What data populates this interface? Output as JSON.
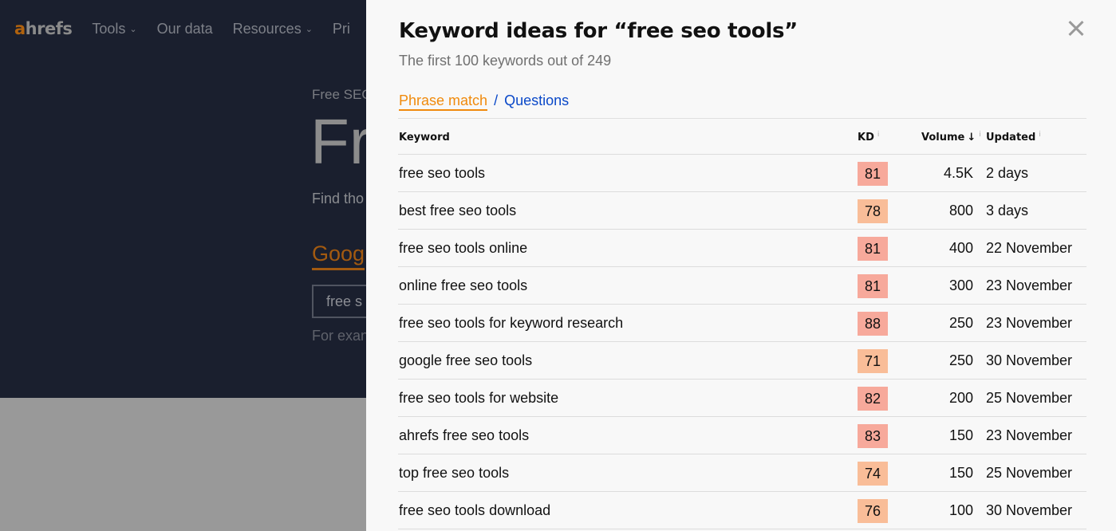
{
  "background": {
    "logo": {
      "accent": "a",
      "rest": "hrefs"
    },
    "nav": [
      {
        "label": "Tools",
        "has_dropdown": true
      },
      {
        "label": "Our data",
        "has_dropdown": false
      },
      {
        "label": "Resources",
        "has_dropdown": true
      },
      {
        "label": "Pri",
        "has_dropdown": false
      }
    ],
    "hero": {
      "eyebrow": "Free SEO",
      "title": "Fr",
      "subtitle": "Find tho",
      "tab": "Goog",
      "input_value": "free s",
      "example": "For exan"
    }
  },
  "modal": {
    "title": "Keyword ideas for “free seo tools”",
    "subtitle": "The first 100 keywords out of 249",
    "tabs": {
      "active": "Phrase match",
      "separator": "/",
      "other": "Questions"
    },
    "colors": {
      "kd_high": "#f7a99b",
      "kd_mid": "#f9bd98",
      "accent": "#f08a0c",
      "link": "#0a48c8"
    },
    "table": {
      "headers": {
        "keyword": "Keyword",
        "kd": "KD",
        "volume": "Volume",
        "volume_sort": "↓",
        "updated": "Updated",
        "info": "i"
      },
      "rows": [
        {
          "keyword": "free seo tools",
          "kd": "81",
          "volume": "4.5K",
          "updated": "2 days"
        },
        {
          "keyword": "best free seo tools",
          "kd": "78",
          "volume": "800",
          "updated": "3 days"
        },
        {
          "keyword": "free seo tools online",
          "kd": "81",
          "volume": "400",
          "updated": "22 November"
        },
        {
          "keyword": "online free seo tools",
          "kd": "81",
          "volume": "300",
          "updated": "23 November"
        },
        {
          "keyword": "free seo tools for keyword research",
          "kd": "88",
          "volume": "250",
          "updated": "23 November"
        },
        {
          "keyword": "google free seo tools",
          "kd": "71",
          "volume": "250",
          "updated": "30 November"
        },
        {
          "keyword": "free seo tools for website",
          "kd": "82",
          "volume": "200",
          "updated": "25 November"
        },
        {
          "keyword": "ahrefs free seo tools",
          "kd": "83",
          "volume": "150",
          "updated": "23 November"
        },
        {
          "keyword": "top free seo tools",
          "kd": "74",
          "volume": "150",
          "updated": "25 November"
        },
        {
          "keyword": "free seo tools download",
          "kd": "76",
          "volume": "100",
          "updated": "30 November"
        }
      ]
    }
  }
}
